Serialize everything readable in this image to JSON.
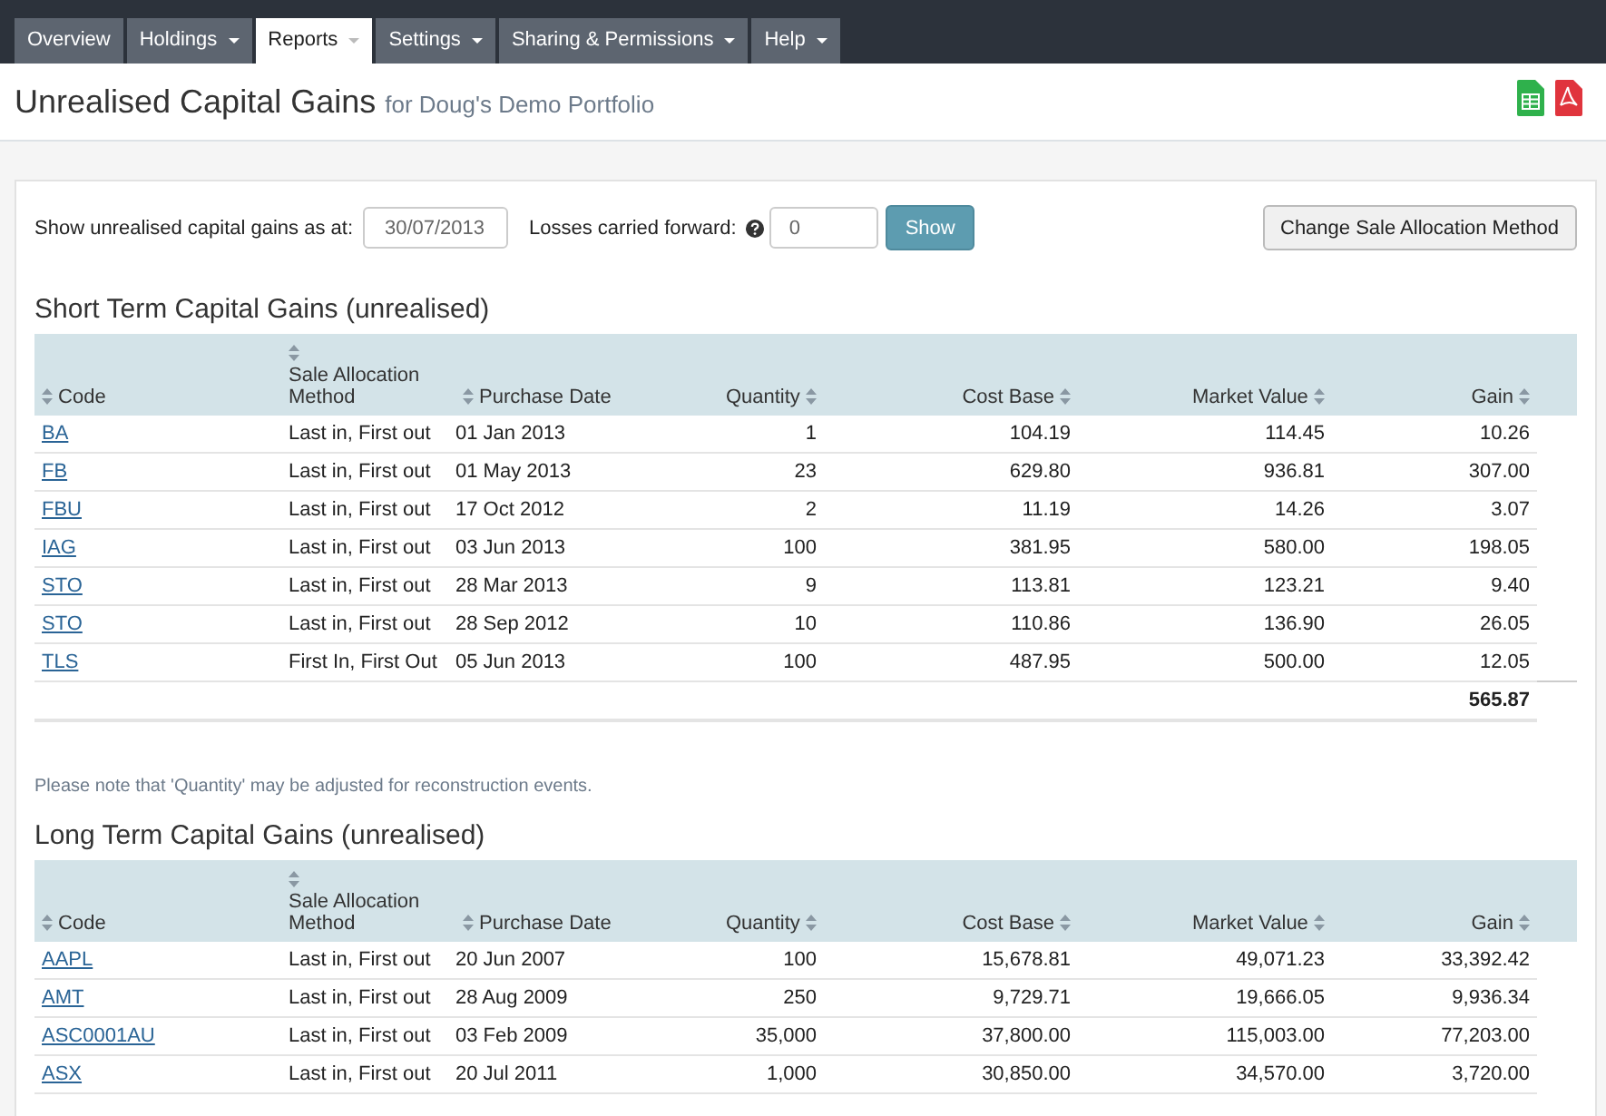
{
  "nav_tabs": [
    {
      "label": "Overview",
      "selected": false,
      "has_menu": false
    },
    {
      "label": "Holdings",
      "selected": false,
      "has_menu": true
    },
    {
      "label": "Reports",
      "selected": true,
      "has_menu": true
    },
    {
      "label": "Settings",
      "selected": false,
      "has_menu": true
    },
    {
      "label": "Sharing & Permissions",
      "selected": false,
      "has_menu": true
    },
    {
      "label": "Help",
      "selected": false,
      "has_menu": true
    }
  ],
  "header": {
    "title": "Unrealised Capital Gains",
    "subtitle": "for Doug's Demo Portfolio",
    "exports": [
      {
        "kind": "spreadsheet"
      },
      {
        "kind": "pdf"
      }
    ]
  },
  "filters": {
    "date_label": "Show unrealised capital gains as at:",
    "date_value": "30/07/2013",
    "losses_label": "Losses carried forward:",
    "losses_value": "0",
    "show_button": "Show",
    "change_button": "Change Sale Allocation Method"
  },
  "sections": [
    {
      "title": "Short Term Capital Gains (unrealised)",
      "columns": [
        {
          "label": "Code",
          "kind": "code"
        },
        {
          "label": "Sale Allocation Method",
          "kind": "method"
        },
        {
          "label": "Purchase Date",
          "kind": "date"
        },
        {
          "label": "Quantity",
          "kind": "number"
        },
        {
          "label": "Cost Base",
          "kind": "number"
        },
        {
          "label": "Market Value",
          "kind": "number"
        },
        {
          "label": "Gain",
          "kind": "number"
        }
      ],
      "rows": [
        [
          "BA",
          "Last in, First out",
          "01 Jan 2013",
          "1",
          "104.19",
          "114.45",
          "10.26"
        ],
        [
          "FB",
          "Last in, First out",
          "01 May 2013",
          "23",
          "629.80",
          "936.81",
          "307.00"
        ],
        [
          "FBU",
          "Last in, First out",
          "17 Oct 2012",
          "2",
          "11.19",
          "14.26",
          "3.07"
        ],
        [
          "IAG",
          "Last in, First out",
          "03 Jun 2013",
          "100",
          "381.95",
          "580.00",
          "198.05"
        ],
        [
          "STO",
          "Last in, First out",
          "28 Mar 2013",
          "9",
          "113.81",
          "123.21",
          "9.40"
        ],
        [
          "STO",
          "Last in, First out",
          "28 Sep 2012",
          "10",
          "110.86",
          "136.90",
          "26.05"
        ],
        [
          "TLS",
          "First In, First Out",
          "05 Jun 2013",
          "100",
          "487.95",
          "500.00",
          "12.05"
        ]
      ],
      "total": "565.87",
      "note": "Please note that 'Quantity' may be adjusted for reconstruction events."
    },
    {
      "title": "Long Term Capital Gains (unrealised)",
      "columns": [
        {
          "label": "Code",
          "kind": "code"
        },
        {
          "label": "Sale Allocation Method",
          "kind": "method"
        },
        {
          "label": "Purchase Date",
          "kind": "date"
        },
        {
          "label": "Quantity",
          "kind": "number"
        },
        {
          "label": "Cost Base",
          "kind": "number"
        },
        {
          "label": "Market Value",
          "kind": "number"
        },
        {
          "label": "Gain",
          "kind": "number"
        }
      ],
      "rows": [
        [
          "AAPL",
          "Last in, First out",
          "20 Jun 2007",
          "100",
          "15,678.81",
          "49,071.23",
          "33,392.42"
        ],
        [
          "AMT",
          "Last in, First out",
          "28 Aug 2009",
          "250",
          "9,729.71",
          "19,666.05",
          "9,936.34"
        ],
        [
          "ASC0001AU",
          "Last in, First out",
          "03 Feb 2009",
          "35,000",
          "37,800.00",
          "115,003.00",
          "77,203.00"
        ],
        [
          "ASX",
          "Last in, First out",
          "20 Jul 2011",
          "1,000",
          "30,850.00",
          "34,570.00",
          "3,720.00"
        ]
      ]
    }
  ]
}
